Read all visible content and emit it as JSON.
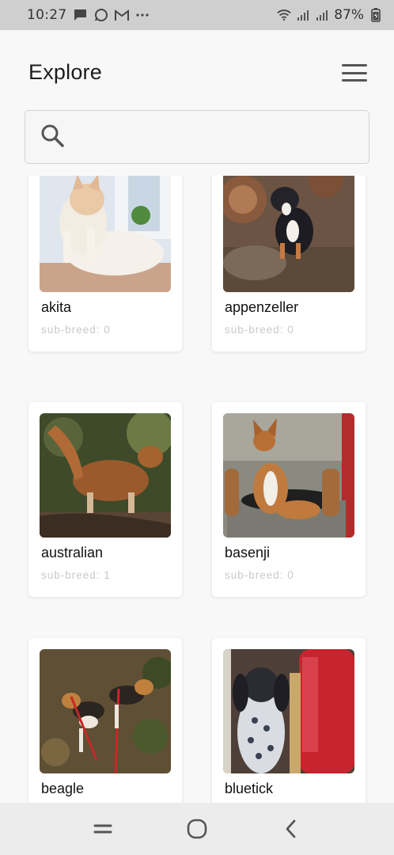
{
  "status_bar": {
    "time": "10:27",
    "left_icons": [
      "message-icon",
      "whatsapp-icon",
      "gmail-icon",
      "more-dots-icon"
    ],
    "battery": "87%",
    "right_icons": [
      "wifi-icon",
      "signal-icon",
      "signal-icon",
      "battery-icon"
    ]
  },
  "header": {
    "title": "Explore",
    "menu_icon": "hamburger-menu-icon"
  },
  "search": {
    "icon": "search-icon",
    "value": "",
    "placeholder": ""
  },
  "breeds": [
    {
      "name": "akita",
      "sub_breed_label": "sub-breed: 0"
    },
    {
      "name": "appenzeller",
      "sub_breed_label": "sub-breed: 0"
    },
    {
      "name": "australian",
      "sub_breed_label": "sub-breed: 1"
    },
    {
      "name": "basenji",
      "sub_breed_label": "sub-breed: 0"
    },
    {
      "name": "beagle",
      "sub_breed_label": ""
    },
    {
      "name": "bluetick",
      "sub_breed_label": ""
    }
  ],
  "nav_bar": {
    "icons": [
      "recent-apps-icon",
      "home-icon",
      "back-icon"
    ]
  }
}
